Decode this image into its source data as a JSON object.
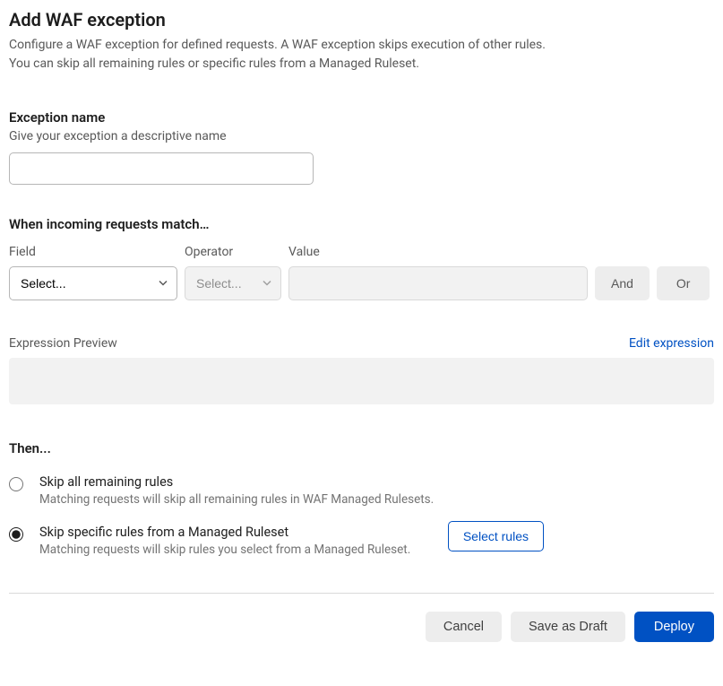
{
  "header": {
    "title": "Add WAF exception",
    "subtitle_line1": "Configure a WAF exception for defined requests. A WAF exception skips execution of other rules.",
    "subtitle_line2": "You can skip all remaining rules or specific rules from a Managed Ruleset."
  },
  "exception": {
    "heading": "Exception name",
    "subtext": "Give your exception a descriptive name",
    "value": ""
  },
  "match": {
    "heading": "When incoming requests match…",
    "field_label": "Field",
    "operator_label": "Operator",
    "value_label": "Value",
    "field_placeholder": "Select...",
    "operator_placeholder": "Select...",
    "value_value": "",
    "and_label": "And",
    "or_label": "Or"
  },
  "preview": {
    "label": "Expression Preview",
    "edit_link": "Edit expression"
  },
  "then": {
    "heading": "Then...",
    "options": [
      {
        "title": "Skip all remaining rules",
        "desc": "Matching requests will skip all remaining rules in WAF Managed Rulesets."
      },
      {
        "title": "Skip specific rules from a Managed Ruleset",
        "desc": "Matching requests will skip rules you select from a Managed Ruleset."
      }
    ],
    "select_rules_label": "Select rules"
  },
  "footer": {
    "cancel": "Cancel",
    "save_draft": "Save as Draft",
    "deploy": "Deploy"
  }
}
